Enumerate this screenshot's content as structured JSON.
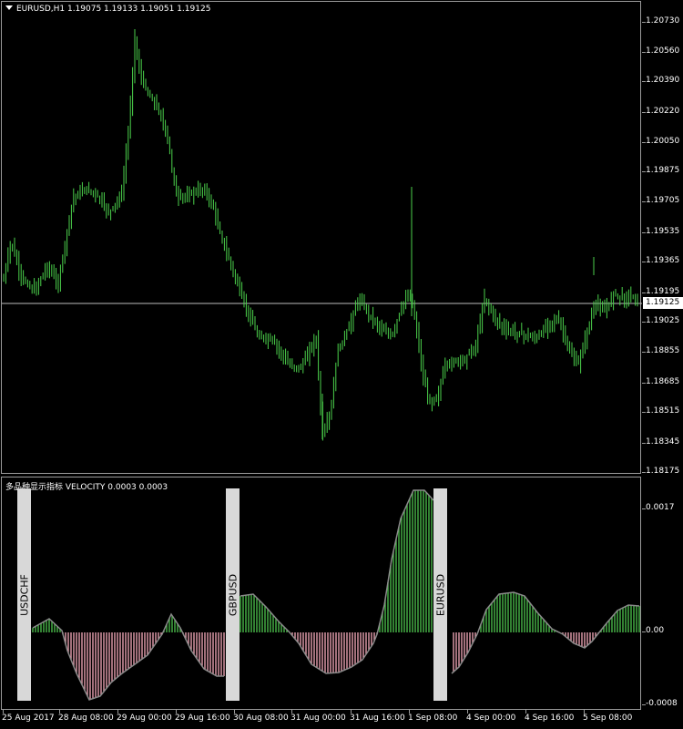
{
  "window": {
    "title": "EURUSD,H1  1.19075 1.19133 1.19051 1.19125",
    "indicator_title": "多品种显示指标 VELOCITY 0.0003 0.0003"
  },
  "colors": {
    "bull": "#4bd14b",
    "hist_pos": "#49b849",
    "hist_neg": "#e8a0b0",
    "velocity_line": "#8a8a8a",
    "grid": "#9a9a9a"
  },
  "price_axis": {
    "labels": [
      "1.20730",
      "1.20560",
      "1.20390",
      "1.20220",
      "1.20050",
      "1.19875",
      "1.19705",
      "1.19535",
      "1.19365",
      "1.19195",
      "1.19025",
      "1.18855",
      "1.18685",
      "1.18515",
      "1.18345",
      "1.18175"
    ],
    "current": "1.19125"
  },
  "indicator_axis": {
    "labels": [
      "0.0017",
      "0.00",
      "-0.0008"
    ]
  },
  "time_axis": [
    "25 Aug 2017",
    "28 Aug 08:00",
    "29 Aug 00:00",
    "29 Aug 16:00",
    "30 Aug 08:00",
    "31 Aug 00:00",
    "31 Aug 16:00",
    "1 Sep 08:00",
    "4 Sep 00:00",
    "4 Sep 16:00",
    "5 Sep 08:00"
  ],
  "symbols": [
    "USDCHF",
    "GBPUSD",
    "EURUSD"
  ]
}
